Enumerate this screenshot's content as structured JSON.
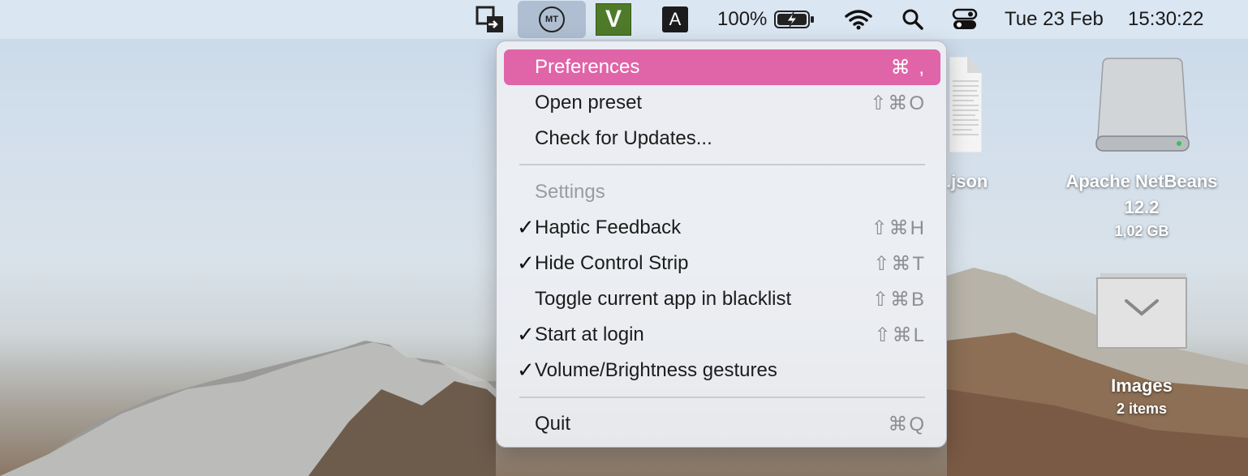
{
  "menubar": {
    "icons": [
      "display-switch-icon",
      "multitouch-icon",
      "vim-icon",
      "input-source-icon",
      "battery-icon",
      "wifi-icon",
      "search-icon",
      "control-center-icon"
    ],
    "multitouch_label": "MT",
    "vim_label": "V",
    "input_source_label": "A",
    "battery_percent": "100%",
    "battery_level": 1.0,
    "date": "Tue 23 Feb",
    "time": "15:30:22"
  },
  "menu": {
    "items": [
      {
        "label": "Preferences",
        "shortcut": "⌘ ,",
        "checked": false,
        "highlighted": true
      },
      {
        "label": "Open preset",
        "shortcut": "⇧⌘O",
        "checked": false
      },
      {
        "label": "Check for Updates...",
        "shortcut": "",
        "checked": false
      },
      {
        "label": "Settings",
        "shortcut": "",
        "header": true
      },
      {
        "label": "Haptic Feedback",
        "shortcut": "⇧⌘H",
        "checked": true
      },
      {
        "label": "Hide Control Strip",
        "shortcut": "⇧⌘T",
        "checked": true
      },
      {
        "label": "Toggle current app in blacklist",
        "shortcut": "⇧⌘B",
        "checked": false
      },
      {
        "label": "Start at login",
        "shortcut": "⇧⌘L",
        "checked": true
      },
      {
        "label": "Volume/Brightness gestures",
        "shortcut": "",
        "checked": true
      },
      {
        "label": "Quit",
        "shortcut": "⌘Q",
        "checked": false
      }
    ],
    "check_glyph": "✓",
    "highlight_color": "#e064a8"
  },
  "desktop": {
    "json_file_label": ".json",
    "netbeans": {
      "name": "Apache NetBeans",
      "version": "12.2",
      "size": "1,02 GB"
    },
    "images_folder": {
      "name": "Images",
      "count": "2 items"
    }
  }
}
